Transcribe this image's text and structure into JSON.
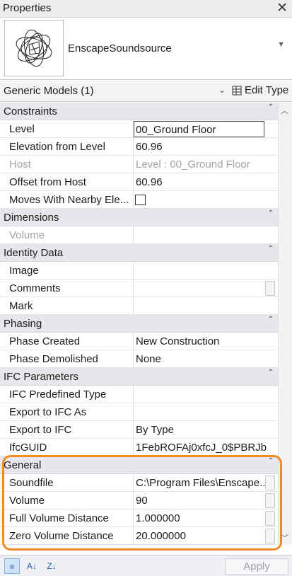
{
  "window": {
    "title": "Properties",
    "close_glyph": "✕"
  },
  "type_selector": {
    "type_name": "EnscapeSoundsource",
    "thumbnail_icon": "sound-source-preview-icon",
    "dropdown_glyph": "▼"
  },
  "instance_filter": {
    "category": "Generic Models (1)",
    "dropdown_glyph": "⌄",
    "edit_type_label": "Edit Type",
    "edit_type_icon": "edit-type-icon"
  },
  "groups": {
    "constraints": {
      "title": "Constraints",
      "rows": [
        {
          "name": "Level",
          "value": "00_Ground Floor"
        },
        {
          "name": "Elevation from Level",
          "value": "60.96"
        },
        {
          "name": "Host",
          "value": "Level : 00_Ground Floor"
        },
        {
          "name": "Offset from Host",
          "value": "60.96"
        },
        {
          "name": "Moves With Nearby Ele...",
          "value": ""
        }
      ]
    },
    "dimensions": {
      "title": "Dimensions",
      "rows": [
        {
          "name": "Volume",
          "value": ""
        }
      ]
    },
    "identity": {
      "title": "Identity Data",
      "rows": [
        {
          "name": "Image",
          "value": ""
        },
        {
          "name": "Comments",
          "value": ""
        },
        {
          "name": "Mark",
          "value": ""
        }
      ]
    },
    "phasing": {
      "title": "Phasing",
      "rows": [
        {
          "name": "Phase Created",
          "value": "New Construction"
        },
        {
          "name": "Phase Demolished",
          "value": "None"
        }
      ]
    },
    "ifc": {
      "title": "IFC Parameters",
      "rows": [
        {
          "name": "IFC Predefined Type",
          "value": ""
        },
        {
          "name": "Export to IFC As",
          "value": ""
        },
        {
          "name": "Export to IFC",
          "value": "By Type"
        },
        {
          "name": "IfcGUID",
          "value": "1FebROFAj0xfcJ_0$PBRJb"
        }
      ]
    },
    "general": {
      "title": "General",
      "rows": [
        {
          "name": "Soundfile",
          "value": "C:\\Program Files\\Enscape..."
        },
        {
          "name": "Volume",
          "value": "90"
        },
        {
          "name": "Full Volume Distance",
          "value": "1.000000"
        },
        {
          "name": "Zero Volume Distance",
          "value": "20.000000"
        }
      ]
    }
  },
  "collapse_glyph": "⌃",
  "scroll_up_glyph": "︿",
  "scroll_down_glyph": "﹀",
  "bottom": {
    "sort_icons": [
      "categorized-sort-icon",
      "sort-ascending-icon",
      "sort-descending-icon"
    ],
    "sort_glyphs": [
      "≡",
      "A↓",
      "Z↓"
    ],
    "apply_label": "Apply"
  },
  "colors": {
    "highlight": "#f08a24",
    "group_bg": "#e6e7ea",
    "accent": "#2a5d9c"
  }
}
